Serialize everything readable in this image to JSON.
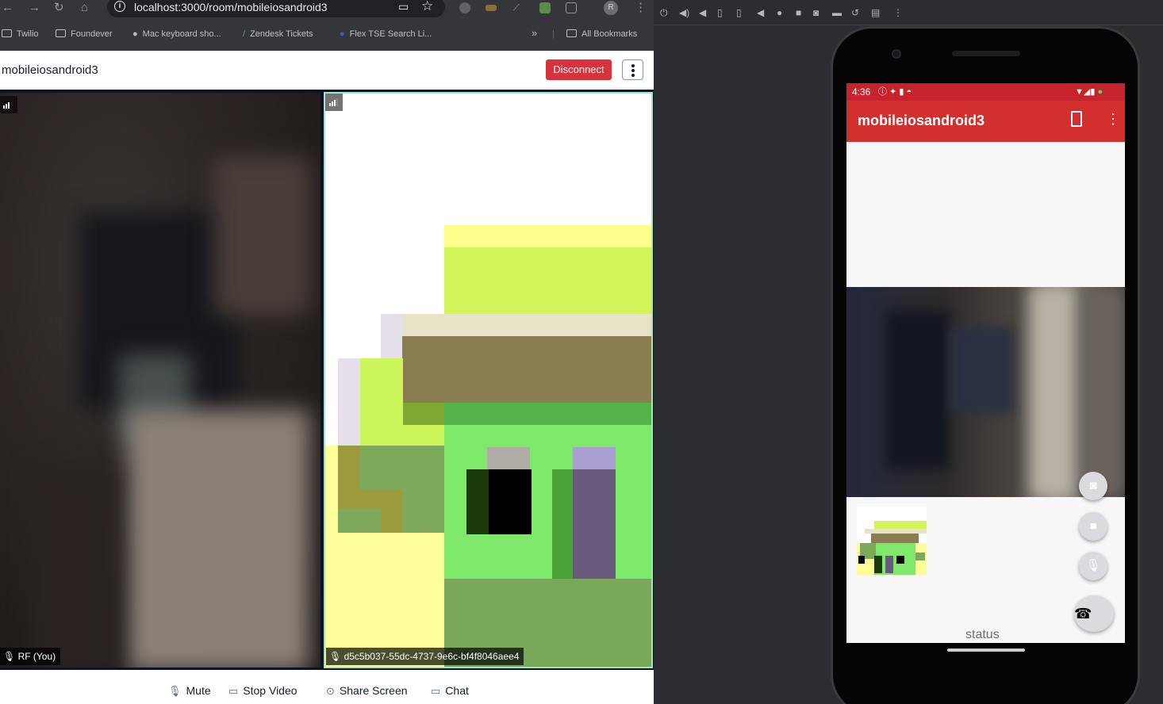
{
  "browser": {
    "url": "localhost:3000/room/mobileiosandroid3",
    "profile_initial": "R",
    "bookmarks": [
      {
        "label": "Twilio"
      },
      {
        "label": "Foundever"
      },
      {
        "label": "Mac keyboard sho..."
      },
      {
        "label": "Zendesk Tickets"
      },
      {
        "label": "Flex TSE Search Li..."
      }
    ],
    "bookmarks_overflow": "»",
    "all_bookmarks": "All Bookmarks"
  },
  "room": {
    "name": "mobileiosandroid3",
    "disconnect_label": "Disconnect"
  },
  "participants": {
    "local_name": "RF (You)",
    "remote_identity": "d5c5b037-55dc-4737-9e6c-bf4f8046aee4"
  },
  "controls": {
    "mute": "Mute",
    "stop_video": "Stop Video",
    "share_screen": "Share Screen",
    "chat": "Chat"
  },
  "phone": {
    "time": "4:36",
    "app_title": "mobileiosandroid3",
    "status_text": "status"
  },
  "colors": {
    "disconnect": "#d6333d",
    "app_bar": "#d32f2f",
    "dominant_border": "#a9e1cf"
  }
}
